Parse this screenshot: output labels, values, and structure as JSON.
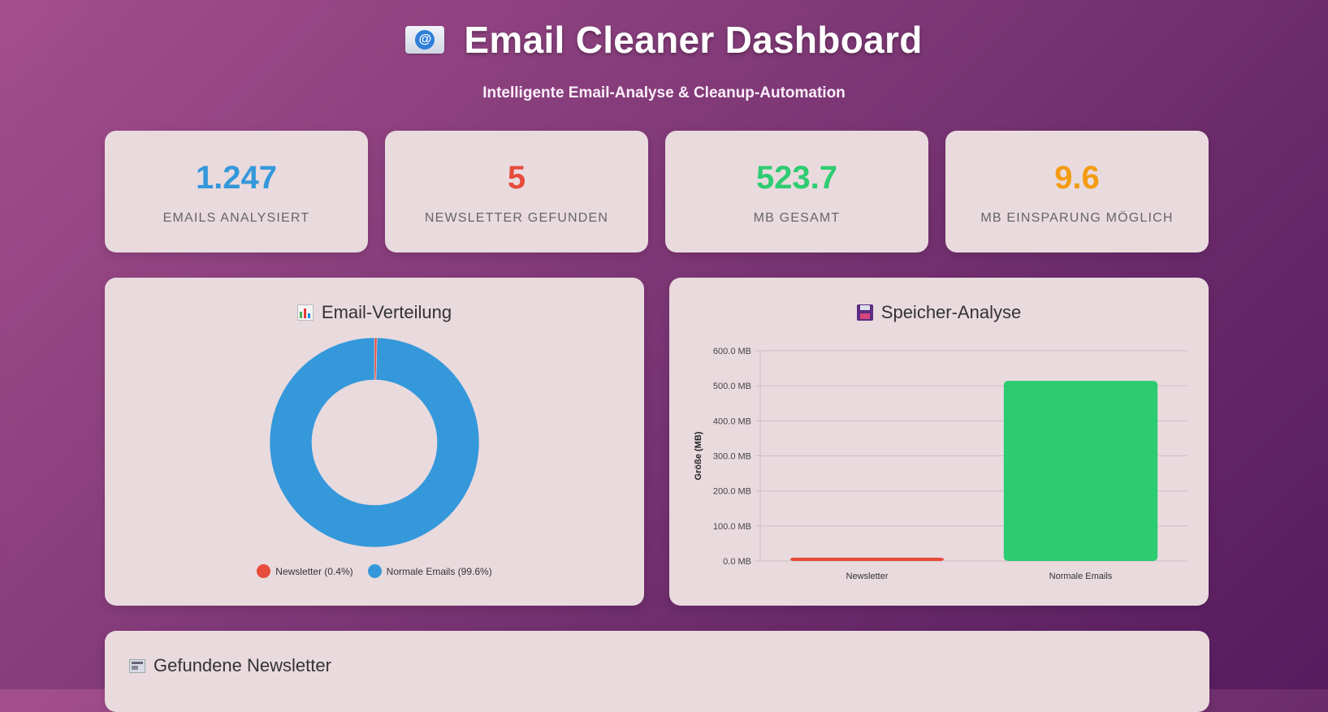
{
  "header": {
    "title": "Email Cleaner Dashboard",
    "subtitle": "Intelligente Email-Analyse & Cleanup-Automation",
    "icon": "email-at-icon"
  },
  "stats": [
    {
      "value": "1.247",
      "label": "Emails analysiert",
      "color": "#3498db"
    },
    {
      "value": "5",
      "label": "Newsletter gefunden",
      "color": "#e74c3c"
    },
    {
      "value": "523.7",
      "label": "MB gesamt",
      "color": "#2ecc71"
    },
    {
      "value": "9.6",
      "label": "MB Einsparung möglich",
      "color": "#f39c12"
    }
  ],
  "distribution": {
    "title": "Email-Verteilung",
    "icon": "bar-chart-icon",
    "legend": [
      "Newsletter (0.4%)",
      "Normale Emails (99.6%)"
    ]
  },
  "storage": {
    "title": "Speicher-Analyse",
    "icon": "floppy-disk-icon"
  },
  "newsletters": {
    "title": "Gefundene Newsletter",
    "icon": "newspaper-icon"
  },
  "chart_data": [
    {
      "type": "pie",
      "style": "doughnut",
      "title": "Email-Verteilung",
      "categories": [
        "Newsletter",
        "Normale Emails"
      ],
      "values": [
        0.4,
        99.6
      ],
      "colors": [
        "#e74c3c",
        "#3498db"
      ],
      "legend": "bottom"
    },
    {
      "type": "bar",
      "title": "Speicher-Analyse",
      "categories": [
        "Newsletter",
        "Normale Emails"
      ],
      "values": [
        9.6,
        514.1
      ],
      "colors": [
        "#e74c3c",
        "#2ecc71"
      ],
      "ylabel": "Größe (MB)",
      "xlabel": "",
      "ylim": [
        0,
        600
      ],
      "yticks": [
        "0.0 MB",
        "100.0 MB",
        "200.0 MB",
        "300.0 MB",
        "400.0 MB",
        "500.0 MB",
        "600.0 MB"
      ],
      "grid": true
    }
  ]
}
